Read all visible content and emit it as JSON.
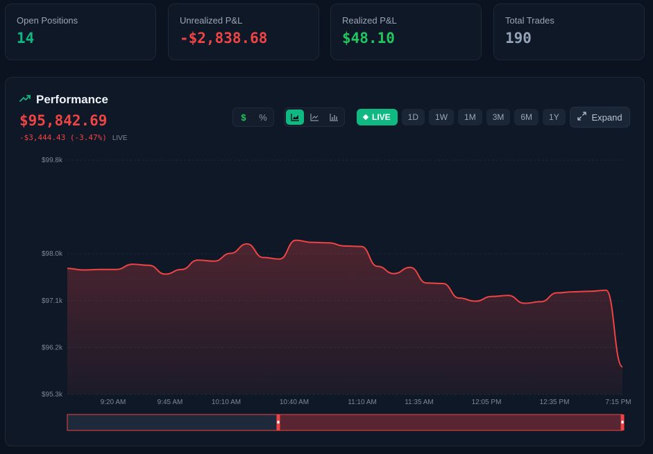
{
  "stats": [
    {
      "label": "Open Positions",
      "value": "14",
      "color": "#10b981"
    },
    {
      "label": "Unrealized P&L",
      "value": "-$2,838.68",
      "color": "#ef4444"
    },
    {
      "label": "Realized P&L",
      "value": "$48.10",
      "color": "#22c55e"
    },
    {
      "label": "Total Trades",
      "value": "190",
      "color": "#94a3b8"
    }
  ],
  "performance": {
    "title": "Performance",
    "icon": "trending-up-icon",
    "value": "$95,842.69",
    "change": "-$3,444.43 (-3.47%)",
    "live_label": "LIVE"
  },
  "toolbar": {
    "unit_toggle": [
      {
        "icon": "dollar-icon",
        "glyph": "$"
      },
      {
        "icon": "percent-icon",
        "glyph": "%"
      }
    ],
    "chart_types": [
      {
        "icon": "area-chart-icon",
        "active": true
      },
      {
        "icon": "line-chart-icon",
        "active": false
      },
      {
        "icon": "bar-chart-icon",
        "active": false
      }
    ],
    "ranges": [
      "LIVE",
      "1D",
      "1W",
      "1M",
      "3M",
      "6M",
      "1Y"
    ],
    "active_range": "LIVE",
    "expand_label": "Expand"
  },
  "chart_data": {
    "type": "area",
    "title": "",
    "xlabel": "",
    "ylabel": "",
    "y_ticks": [
      "$99.8k",
      "$98.0k",
      "$97.1k",
      "$96.2k",
      "$95.3k"
    ],
    "ylim": [
      95300,
      99800
    ],
    "x_ticks": [
      "9:20 AM",
      "9:45 AM",
      "10:10 AM",
      "10:40 AM",
      "11:10 AM",
      "11:35 AM",
      "12:05 PM",
      "12:35 PM",
      "7:15 PM"
    ],
    "series": [
      {
        "color": "#ef4444",
        "values": [
          97720,
          97690,
          97700,
          97700,
          97800,
          97780,
          97610,
          97700,
          97880,
          97860,
          98010,
          98190,
          97930,
          97900,
          98260,
          98220,
          98210,
          98150,
          98140,
          97760,
          97620,
          97740,
          97440,
          97430,
          97150,
          97090,
          97180,
          97200,
          97050,
          97080,
          97250,
          97270,
          97280,
          97300,
          95830
        ]
      }
    ],
    "grid": true,
    "legend": "none"
  },
  "range_selector": {
    "selected_fraction_start": 0.38,
    "selected_fraction_end": 1.0
  }
}
